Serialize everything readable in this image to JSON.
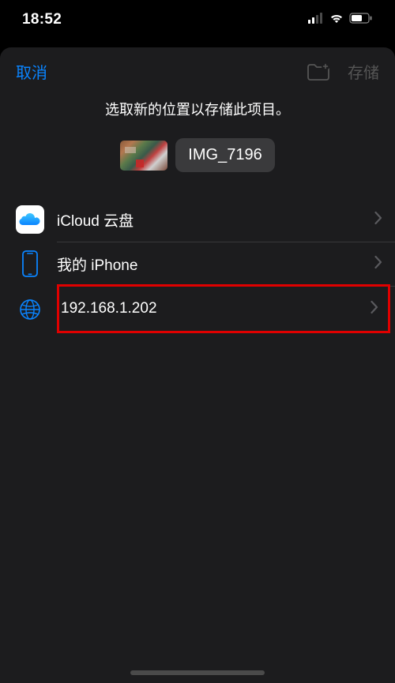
{
  "statusBar": {
    "time": "18:52"
  },
  "header": {
    "cancel": "取消",
    "save": "存储"
  },
  "prompt": "选取新的位置以存储此项目。",
  "file": {
    "name": "IMG_7196"
  },
  "locations": {
    "items": [
      {
        "label": "iCloud 云盘",
        "icon": "icloud-icon"
      },
      {
        "label": "我的 iPhone",
        "icon": "iphone-icon"
      },
      {
        "label": "192.168.1.202",
        "icon": "globe-icon"
      }
    ]
  }
}
